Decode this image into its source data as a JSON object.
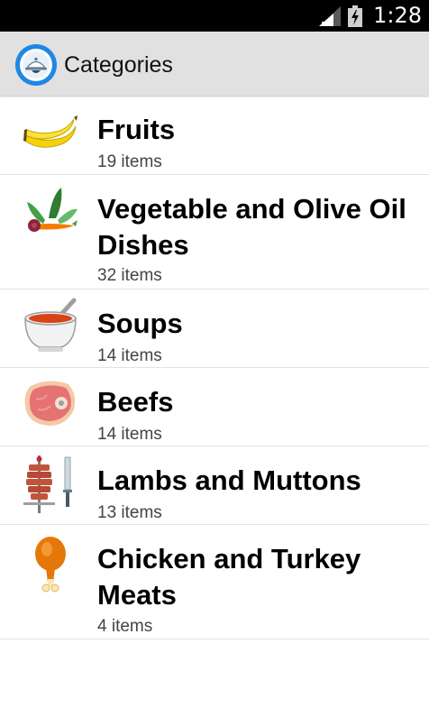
{
  "status_bar": {
    "time": "1:28",
    "icons": [
      "signal-icon",
      "battery-icon"
    ]
  },
  "header": {
    "app_icon": "app-logo-icon",
    "title": "Categories"
  },
  "categories": [
    {
      "name": "Fruits",
      "count": "19 items",
      "icon": "banana-icon"
    },
    {
      "name": "Vegetable and Olive Oil Dishes",
      "count": "32 items",
      "icon": "vegetables-icon"
    },
    {
      "name": "Soups",
      "count": "14 items",
      "icon": "soup-bowl-icon"
    },
    {
      "name": "Beefs",
      "count": "14 items",
      "icon": "steak-icon"
    },
    {
      "name": "Lambs and Muttons",
      "count": "13 items",
      "icon": "doner-kebab-icon"
    },
    {
      "name": "Chicken and Turkey Meats",
      "count": "4 items",
      "icon": "chicken-leg-icon"
    }
  ],
  "colors": {
    "status_bar": "#000000",
    "action_bar": "#e1e1e1",
    "app_icon": "#1e88e5"
  }
}
